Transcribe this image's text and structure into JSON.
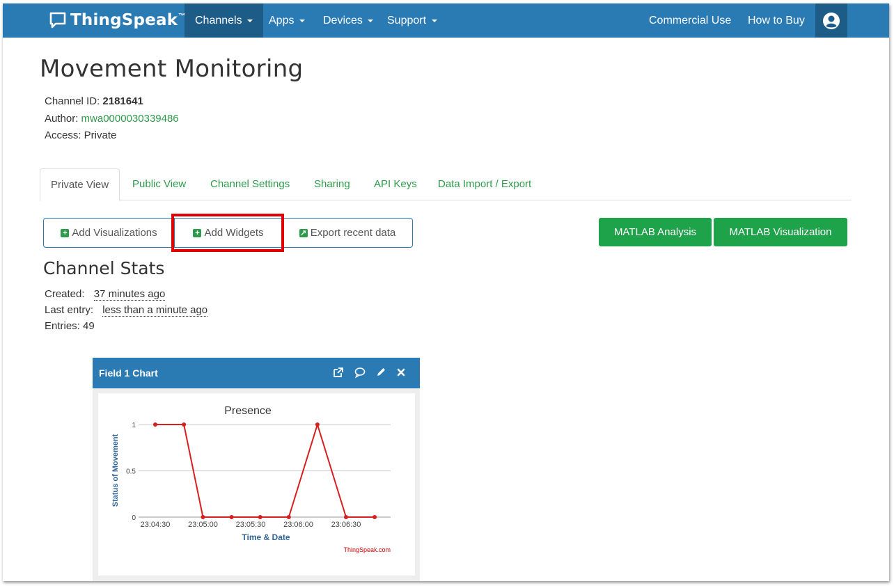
{
  "navbar": {
    "brand": "ThingSpeak",
    "brand_tm": "™",
    "items": [
      {
        "label": "Channels",
        "active": true
      },
      {
        "label": "Apps"
      },
      {
        "label": "Devices"
      },
      {
        "label": "Support"
      }
    ],
    "right_items": [
      {
        "label": "Commercial Use"
      },
      {
        "label": "How to Buy"
      }
    ],
    "user_icon": "user-icon"
  },
  "channel": {
    "title": "Movement Monitoring",
    "id_label": "Channel ID: ",
    "id_value": "2181641",
    "author_label": "Author: ",
    "author_value": "mwa0000030339486",
    "access_label": "Access: Private"
  },
  "tabs": [
    {
      "label": "Private View",
      "active": true
    },
    {
      "label": "Public View"
    },
    {
      "label": "Channel Settings"
    },
    {
      "label": "Sharing"
    },
    {
      "label": "API Keys"
    },
    {
      "label": "Data Import / Export"
    }
  ],
  "actions": {
    "add_visualizations": "Add Visualizations",
    "add_widgets": "Add Widgets",
    "export_recent": "Export recent data",
    "matlab_analysis": "MATLAB Analysis",
    "matlab_visualization": "MATLAB Visualization"
  },
  "stats": {
    "title": "Channel Stats",
    "created_label": "Created:",
    "created_value": "37 minutes ago",
    "last_entry_label": "Last entry:",
    "last_entry_value": "less than a minute ago",
    "entries_label": "Entries: 49"
  },
  "widget": {
    "title": "Field 1 Chart",
    "icons": [
      "external-link-icon",
      "comment-icon",
      "pencil-icon",
      "close-icon"
    ]
  },
  "colors": {
    "navbar": "#2a7ab4",
    "navbar_active": "#1d5c86",
    "green": "#1ea24a",
    "link_green": "#2e9b4a",
    "line": "#d62020",
    "highlight": "#e00000"
  },
  "chart_data": {
    "type": "line",
    "title": "Presence",
    "xlabel": "Time & Date",
    "ylabel": "Status of Movement",
    "credit": "ThingSpeak.com",
    "x_ticks": [
      "23:04:30",
      "23:05:00",
      "23:05:30",
      "23:06:00",
      "23:06:30"
    ],
    "y_ticks": [
      "0",
      "0.5",
      "1"
    ],
    "ylim": [
      0,
      1
    ],
    "grid": true,
    "series": [
      {
        "x": [
          "23:04:30",
          "23:04:48",
          "23:05:00",
          "23:05:18",
          "23:05:36",
          "23:05:54",
          "23:06:12",
          "23:06:30",
          "23:06:48"
        ],
        "values": [
          1,
          1,
          0,
          0,
          0,
          0,
          1,
          0,
          0
        ]
      }
    ]
  }
}
